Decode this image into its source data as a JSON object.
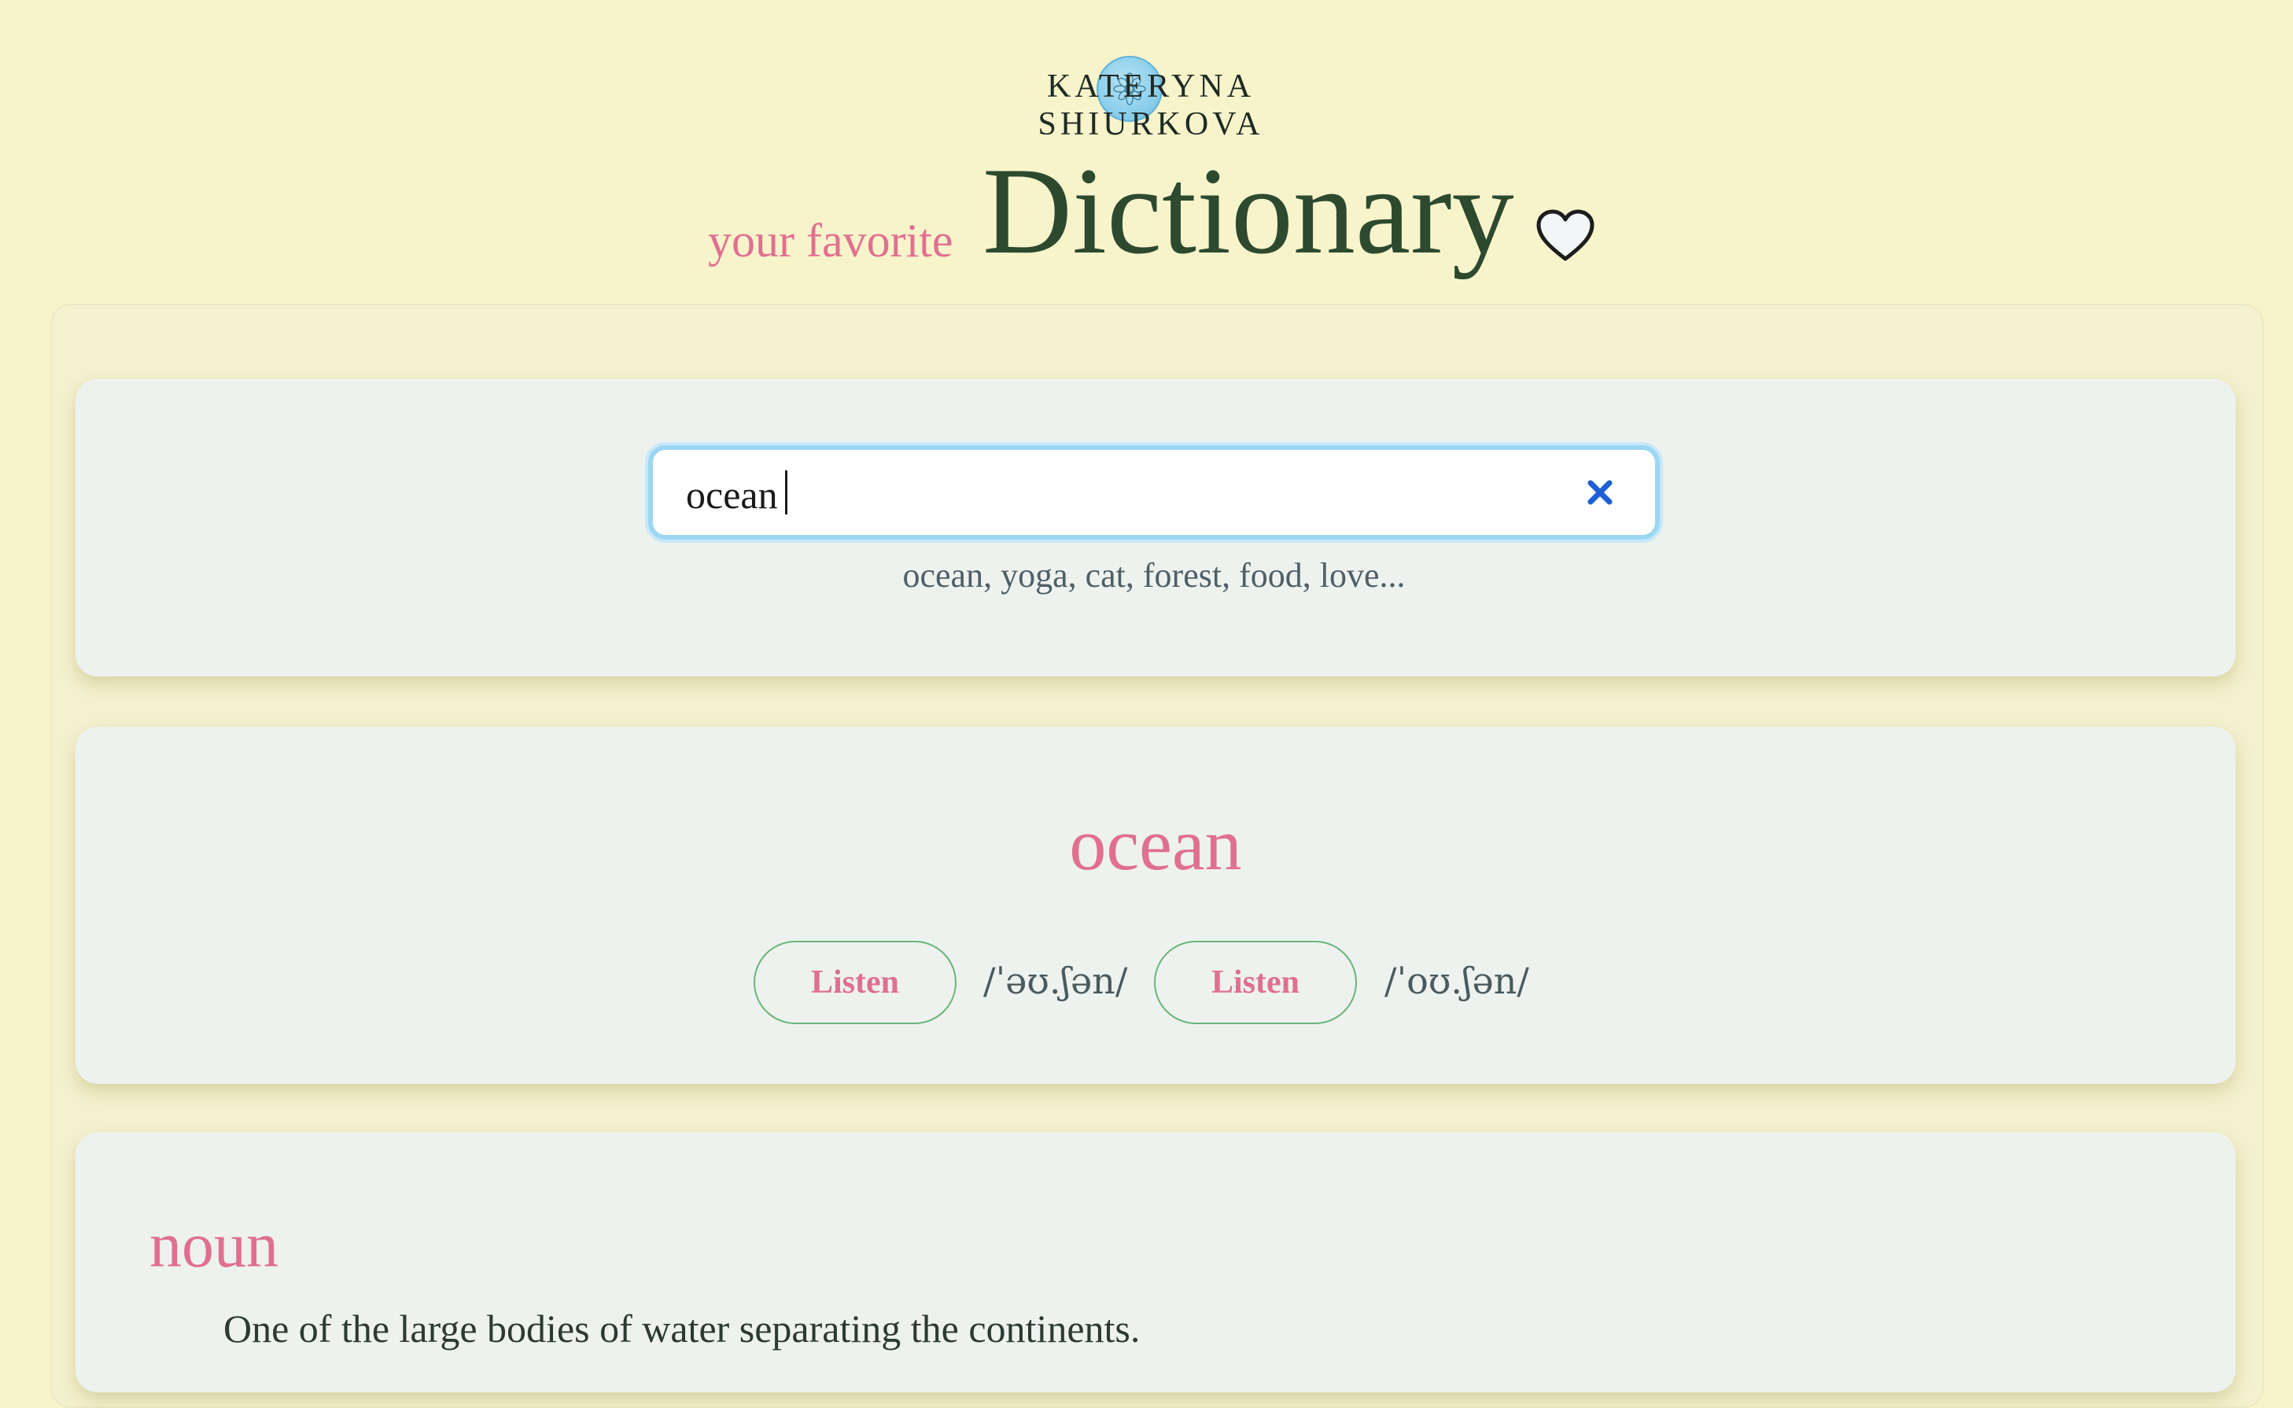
{
  "header": {
    "author_name": "KATERYNA SHIURKOVA",
    "title_prefix": "your favorite",
    "title_main": "Dictionary",
    "heart_icon": "heart-icon"
  },
  "search": {
    "value": "ocean",
    "placeholder": "",
    "hint": "ocean, yoga, cat, forest, food, love...",
    "clear_icon": "close-icon"
  },
  "word": {
    "headword": "ocean",
    "pronunciations": [
      {
        "button_label": "Listen",
        "phonetic": "/ˈəʊ.ʃən/"
      },
      {
        "button_label": "Listen",
        "phonetic": "/ˈoʊ.ʃən/"
      }
    ]
  },
  "meanings": [
    {
      "part_of_speech": "noun",
      "definition": "One of the large bodies of water separating the continents."
    }
  ],
  "colors": {
    "background": "#f7f4cc",
    "card": "#eef2ef",
    "accent_pink": "#e0708f",
    "title_green": "#2d4a2f",
    "button_border": "#6ab57a",
    "focus_blue": "#9dd6f2",
    "clear_blue": "#1f5fd6"
  }
}
